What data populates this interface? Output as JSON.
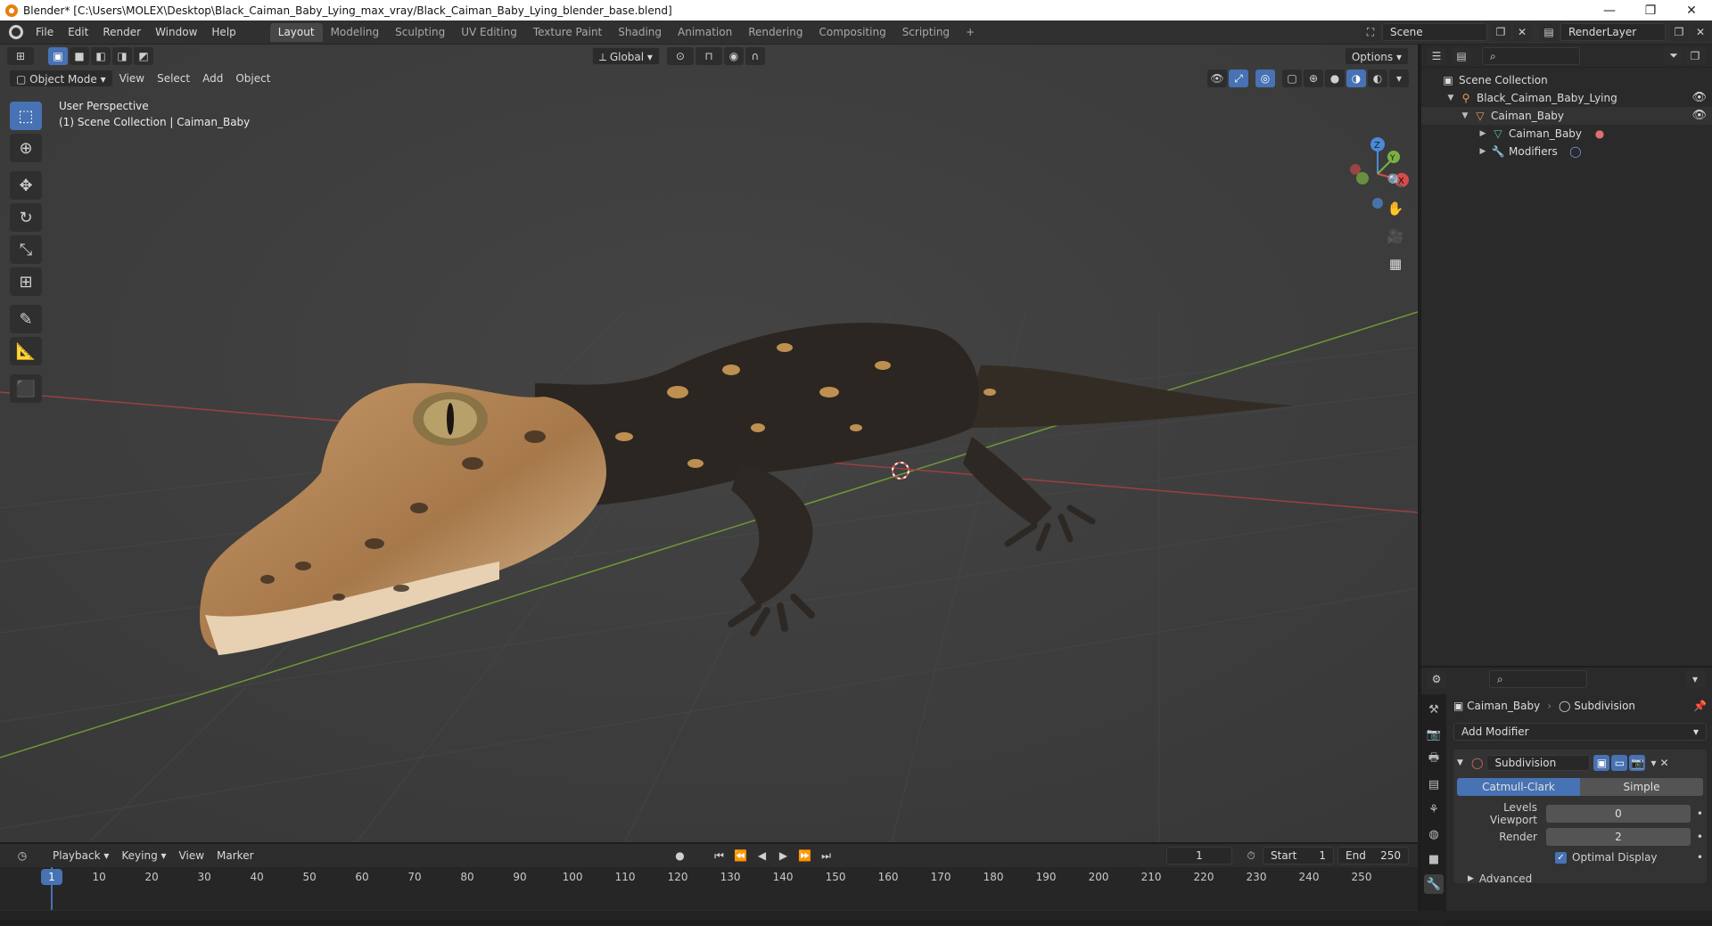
{
  "window": {
    "title": "Blender* [C:\\Users\\MOLEX\\Desktop\\Black_Caiman_Baby_Lying_max_vray/Black_Caiman_Baby_Lying_blender_base.blend]",
    "controls": [
      "—",
      "❐",
      "✕"
    ]
  },
  "menu": [
    "File",
    "Edit",
    "Render",
    "Window",
    "Help"
  ],
  "workspaces": [
    "Layout",
    "Modeling",
    "Sculpting",
    "UV Editing",
    "Texture Paint",
    "Shading",
    "Animation",
    "Rendering",
    "Compositing",
    "Scripting"
  ],
  "active_workspace": "Layout",
  "scene": {
    "name": "Scene",
    "render_layer": "RenderLayer"
  },
  "viewport": {
    "mode": "Object Mode",
    "menus": [
      "View",
      "Select",
      "Add",
      "Object"
    ],
    "orientation": "Global",
    "options_label": "Options",
    "info_line1": "User Perspective",
    "info_line2": "(1) Scene Collection | Caiman_Baby",
    "gizmo_axes": {
      "x": "X",
      "y": "Y",
      "z": "Z"
    }
  },
  "outliner": {
    "root": "Scene Collection",
    "items": [
      {
        "label": "Black_Caiman_Baby_Lying",
        "depth": 1,
        "icon": "armature-icon"
      },
      {
        "label": "Caiman_Baby",
        "depth": 2,
        "icon": "object-icon"
      },
      {
        "label": "Caiman_Baby",
        "depth": 3,
        "icon": "mesh-icon"
      },
      {
        "label": "Modifiers",
        "depth": 3,
        "icon": "wrench-icon"
      }
    ]
  },
  "properties": {
    "object": "Caiman_Baby",
    "modifier_context": "Subdivision",
    "add_modifier": "Add Modifier",
    "modifier_name": "Subdivision",
    "type_options": [
      "Catmull-Clark",
      "Simple"
    ],
    "active_type": "Catmull-Clark",
    "levels_viewport_label": "Levels Viewport",
    "levels_viewport": "0",
    "render_label": "Render",
    "render_value": "2",
    "optimal_display": "Optimal Display",
    "optimal_display_checked": true,
    "advanced": "Advanced"
  },
  "timeline": {
    "menus": [
      "Playback",
      "Keying",
      "View",
      "Marker"
    ],
    "current_frame": "1",
    "start_label": "Start",
    "start": "1",
    "end_label": "End",
    "end": "250",
    "ticks": [
      "1",
      "10",
      "20",
      "30",
      "40",
      "50",
      "60",
      "70",
      "80",
      "90",
      "100",
      "110",
      "120",
      "130",
      "140",
      "150",
      "160",
      "170",
      "180",
      "190",
      "200",
      "210",
      "220",
      "230",
      "240",
      "250"
    ]
  },
  "colors": {
    "accent": "#4772b3",
    "viewport_bg": "#3d3d3d",
    "panel_bg": "#2a2a2a",
    "caiman_skin": "#c99a64",
    "caiman_dark": "#2b2621",
    "axis_x": "#d64b4b",
    "axis_y": "#7ab041",
    "axis_z": "#4c8ad8"
  }
}
